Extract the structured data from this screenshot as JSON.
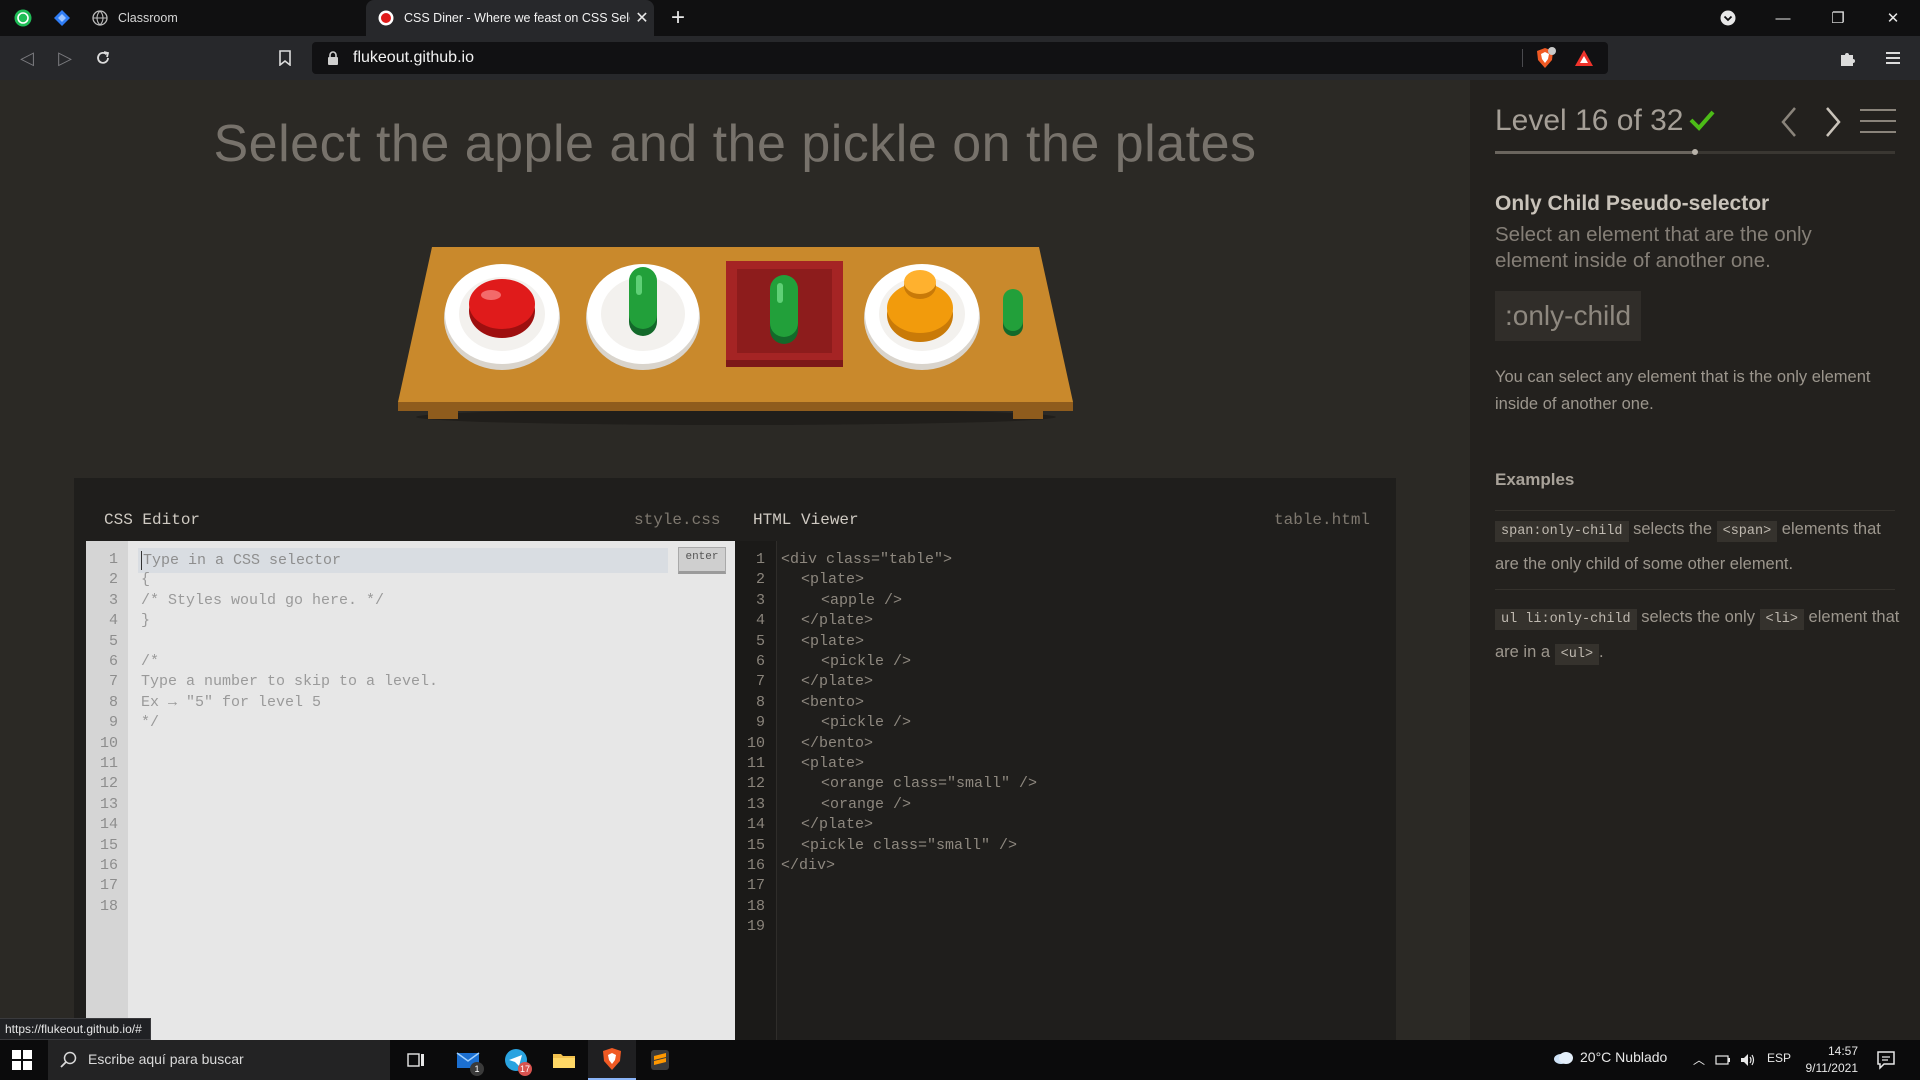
{
  "browser": {
    "tabs": [
      {
        "title": "Classroom"
      },
      {
        "title": "CSS Diner - Where we feast on CSS Selectors!"
      }
    ],
    "address": "flukeout.github.io",
    "status_url": "https://flukeout.github.io/#"
  },
  "game": {
    "instruction": "Select the apple and the pickle on the plates",
    "table_items": [
      {
        "container": "plate",
        "item": "apple",
        "color": "#e01b1b"
      },
      {
        "container": "plate",
        "item": "pickle",
        "color": "#22a03a"
      },
      {
        "container": "bento",
        "item": "pickle",
        "color": "#22a03a"
      },
      {
        "container": "plate",
        "item": "orange",
        "color": "#f29b0c"
      },
      {
        "container": "table",
        "item": "pickle (small)",
        "color": "#22a03a"
      }
    ],
    "colors": {
      "table": "#c9892c",
      "plate": "#ffffff",
      "bento": "#a52424"
    }
  },
  "css_editor": {
    "title": "CSS Editor",
    "file": "style.css",
    "placeholder": "Type in a CSS selector",
    "enter_label": "enter",
    "lines": [
      "",
      "{",
      "/* Styles would go here. */",
      "}",
      "",
      "/*",
      "Type a number to skip to a level.",
      "Ex → \"5\" for level 5",
      "*/"
    ],
    "line_numbers": [
      "1",
      "2",
      "3",
      "4",
      "5",
      "6",
      "7",
      "8",
      "9",
      "10",
      "11",
      "12",
      "13",
      "14",
      "15",
      "16",
      "17",
      "18"
    ]
  },
  "html_viewer": {
    "title": "HTML Viewer",
    "file": "table.html",
    "lines": [
      {
        "indent": 0,
        "text": "<div class=\"table\">"
      },
      {
        "indent": 1,
        "text": "<plate>"
      },
      {
        "indent": 2,
        "text": "<apple />"
      },
      {
        "indent": 1,
        "text": "</plate>"
      },
      {
        "indent": 1,
        "text": "<plate>"
      },
      {
        "indent": 2,
        "text": "<pickle />"
      },
      {
        "indent": 1,
        "text": "</plate>"
      },
      {
        "indent": 1,
        "text": "<bento>"
      },
      {
        "indent": 2,
        "text": "<pickle />"
      },
      {
        "indent": 1,
        "text": "</bento>"
      },
      {
        "indent": 1,
        "text": "<plate>"
      },
      {
        "indent": 2,
        "text": "<orange class=\"small\" />"
      },
      {
        "indent": 2,
        "text": "<orange />"
      },
      {
        "indent": 1,
        "text": "</plate>"
      },
      {
        "indent": 1,
        "text": "<pickle class=\"small\" />"
      },
      {
        "indent": 0,
        "text": "</div>"
      }
    ],
    "line_numbers": [
      "1",
      "2",
      "3",
      "4",
      "5",
      "6",
      "7",
      "8",
      "9",
      "10",
      "11",
      "12",
      "13",
      "14",
      "15",
      "16",
      "17",
      "18",
      "19"
    ]
  },
  "sidebar": {
    "level_label": "Level 16 of 32",
    "level_current": 16,
    "level_total": 32,
    "selector_name": "Only Child Pseudo-selector",
    "selector_title": "Select an element that are the only element inside of another one.",
    "syntax": ":only-child",
    "hint": "You can select any element that is the only element inside of another one.",
    "examples_heading": "Examples",
    "examples": [
      {
        "code": "span:only-child",
        "pre": "selects the",
        "code2": "<span>",
        "post": "elements that are the only child of some other element.",
        "code3": "",
        "end": ""
      },
      {
        "code": "ul li:only-child",
        "pre": "selects the only",
        "code2": "<li>",
        "post": "element that are in a",
        "code3": "<ul>",
        "end": "."
      }
    ]
  },
  "taskbar": {
    "search_placeholder": "Escribe aquí para buscar",
    "mail_badge": "1",
    "telegram_badge": "17",
    "weather": "20°C  Nublado",
    "lang": "ESP",
    "time": "14:57",
    "date": "9/11/2021"
  }
}
